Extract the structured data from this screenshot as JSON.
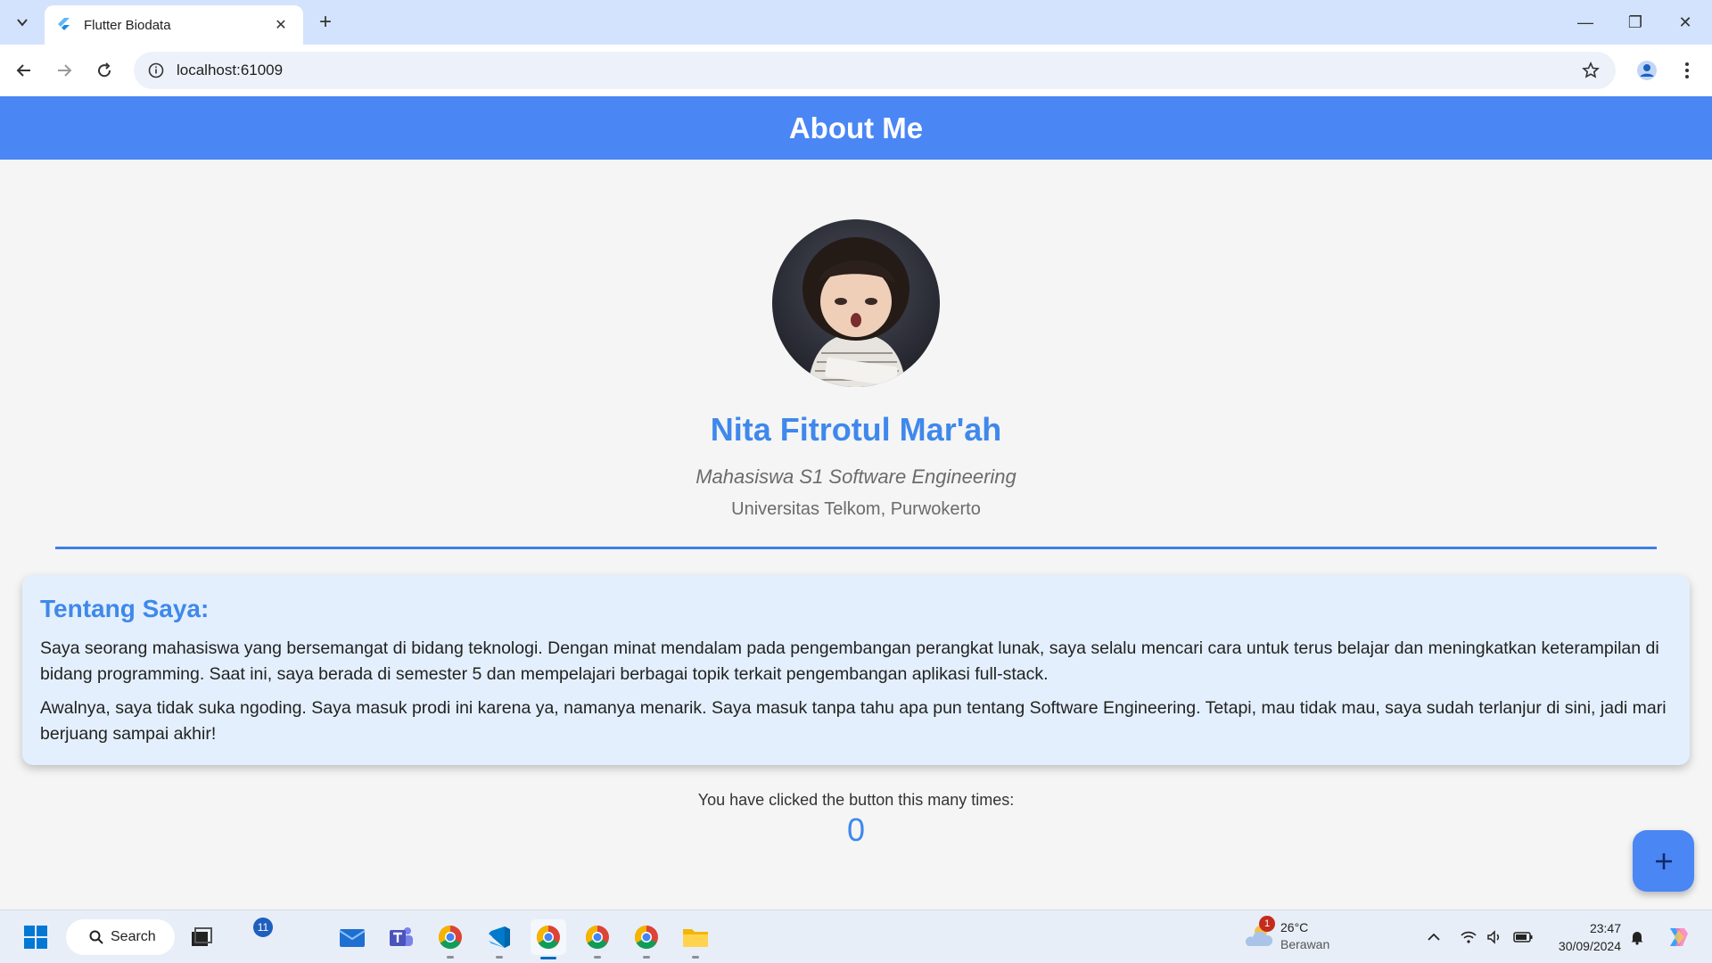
{
  "browser": {
    "tab_title": "Flutter Biodata",
    "url": "localhost:61009",
    "accent_color": "#d3e3fd"
  },
  "app": {
    "appbar_title": "About Me",
    "appbar_color": "#4a86f4",
    "profile": {
      "name": "Nita Fitrotul Mar'ah",
      "role": "Mahasiswa S1 Software Engineering",
      "university": "Universitas Telkom, Purwokerto"
    },
    "about": {
      "title": "Tentang Saya:",
      "paragraphs": [
        "Saya seorang mahasiswa yang bersemangat di bidang teknologi. Dengan minat mendalam pada pengembangan perangkat lunak, saya selalu mencari cara untuk terus belajar dan meningkatkan keterampilan di bidang programming. Saat ini, saya berada di semester 5 dan mempelajari berbagai topik terkait pengembangan aplikasi full-stack.",
        "Awalnya, saya tidak suka ngoding. Saya masuk prodi ini karena ya, namanya menarik. Saya masuk tanpa tahu apa pun tentang Software Engineering. Tetapi, mau tidak mau, saya sudah terlanjur di sini, jadi mari berjuang sampai akhir!"
      ]
    },
    "counter": {
      "label": "You have clicked the button this many times:",
      "value": "0"
    },
    "fab_icon": "plus-icon"
  },
  "taskbar": {
    "search_label": "Search",
    "notification_count": "11",
    "weather": {
      "temp": "26°C",
      "condition": "Berawan",
      "alert_count": "1"
    },
    "clock": {
      "time": "23:47",
      "date": "30/09/2024"
    }
  }
}
